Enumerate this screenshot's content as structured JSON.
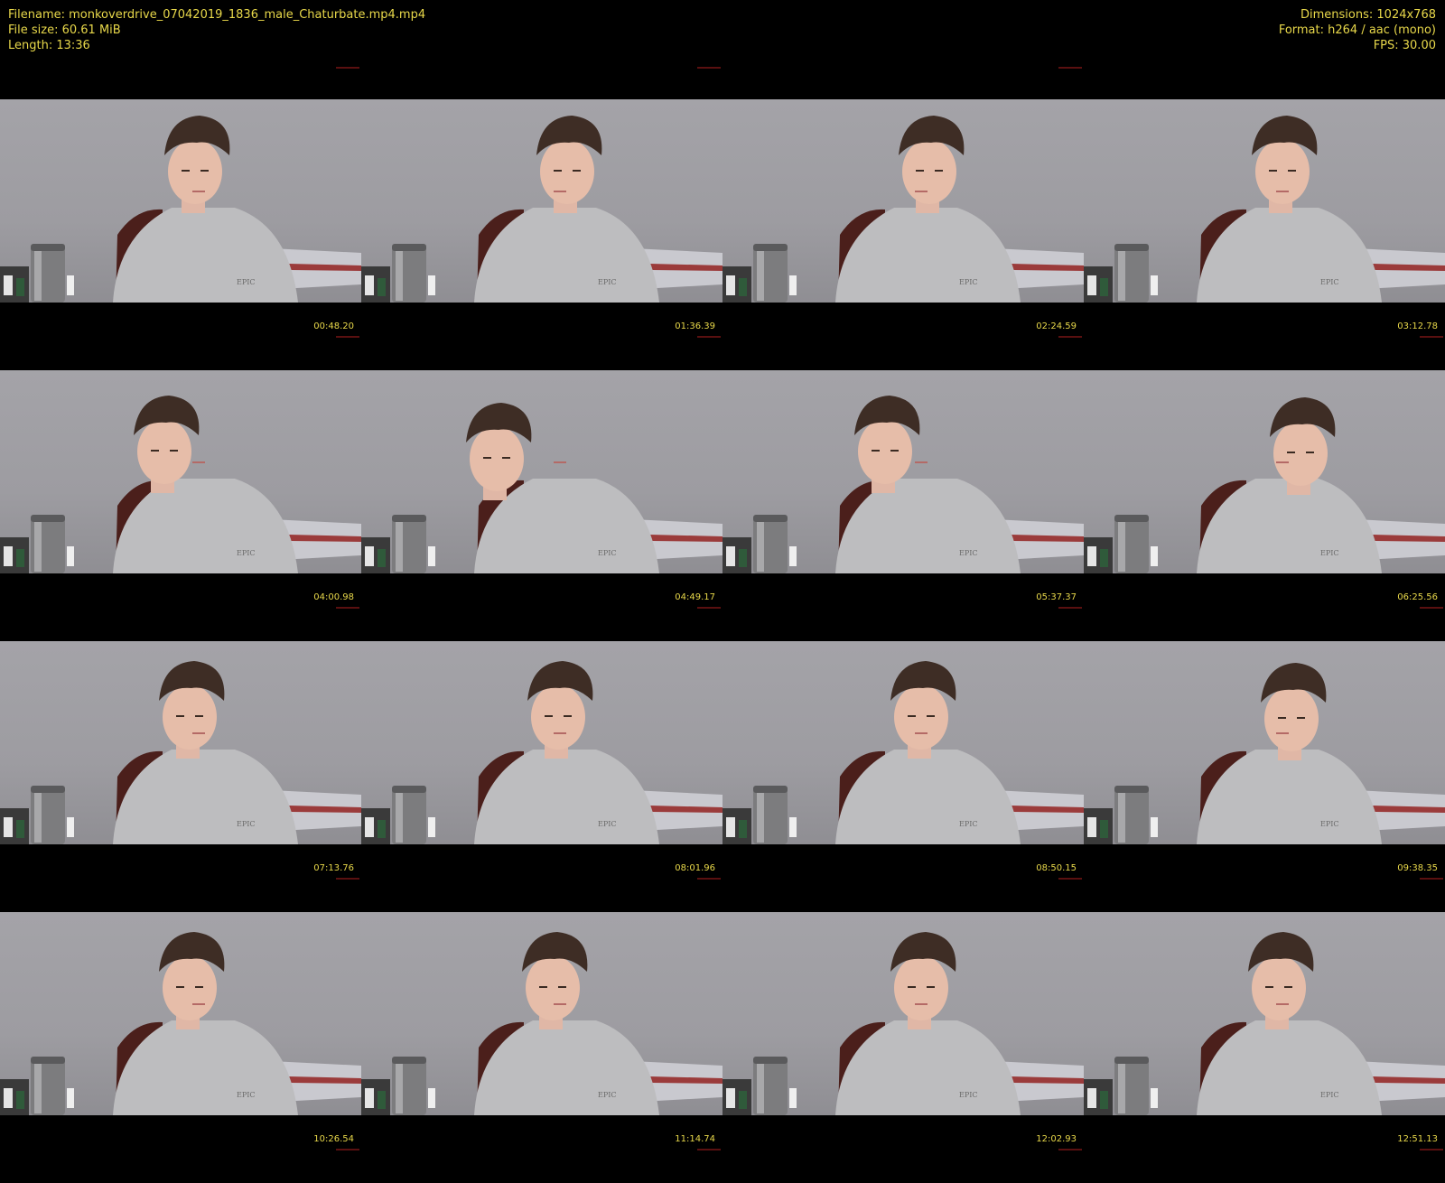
{
  "header": {
    "filename": "Filename: monkoverdrive_07042019_1836_male_Chaturbate.mp4.mp4",
    "file_size": "File size: 60.61 MiB",
    "length": "Length: 13:36",
    "dimensions": "Dimensions: 1024x768",
    "format": "Format: h264 / aac (mono)",
    "fps": "FPS: 30.00"
  },
  "colors": {
    "background": "#000000",
    "text": "#e8d84a",
    "wall": "#a3a2a7"
  },
  "thumbnails": [
    {
      "timestamp": "00:48.20"
    },
    {
      "timestamp": "01:36.39"
    },
    {
      "timestamp": "02:24.59"
    },
    {
      "timestamp": "03:12.78"
    },
    {
      "timestamp": "04:00.98"
    },
    {
      "timestamp": "04:49.17"
    },
    {
      "timestamp": "05:37.37"
    },
    {
      "timestamp": "06:25.56"
    },
    {
      "timestamp": "07:13.76"
    },
    {
      "timestamp": "08:01.96"
    },
    {
      "timestamp": "08:50.15"
    },
    {
      "timestamp": "09:38.35"
    },
    {
      "timestamp": "10:26.54"
    },
    {
      "timestamp": "11:14.74"
    },
    {
      "timestamp": "12:02.93"
    },
    {
      "timestamp": "12:51.13"
    }
  ]
}
